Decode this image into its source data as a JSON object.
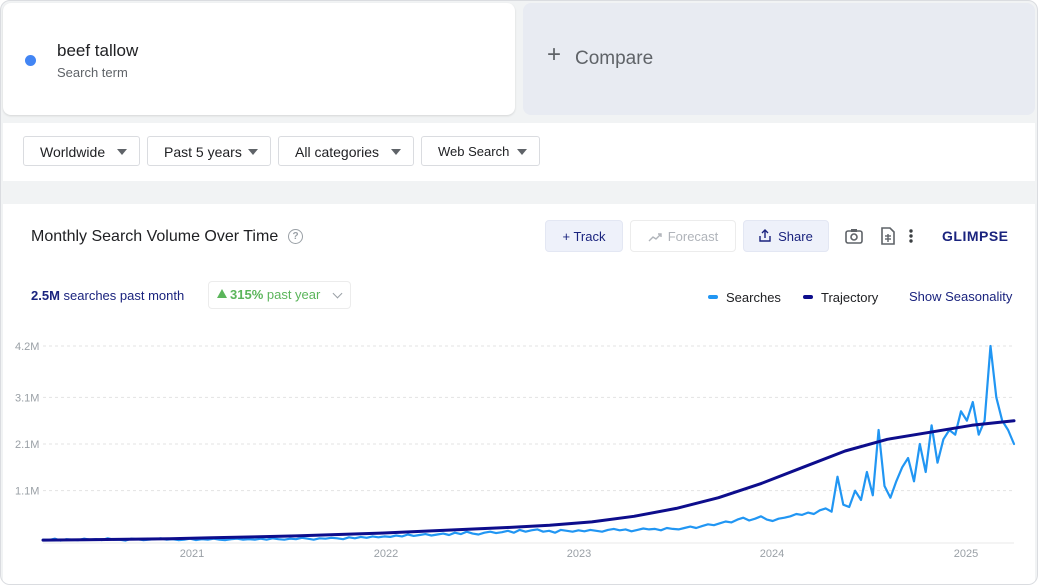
{
  "search_term": {
    "name": "beef tallow",
    "subtitle": "Search term"
  },
  "compare": {
    "label": "Compare"
  },
  "filters": {
    "region": "Worldwide",
    "time": "Past 5 years",
    "category": "All categories",
    "source": "Web Search"
  },
  "panel": {
    "title": "Monthly Search Volume Over Time",
    "track_label": "+ Track",
    "forecast_label": "Forecast",
    "share_label": "Share",
    "logo": "GLIMPSE",
    "searches_value": "2.5M",
    "searches_suffix": "searches past month",
    "growth_value": "315%",
    "growth_suffix": "past year",
    "legend_searches": "Searches",
    "legend_trajectory": "Trajectory",
    "show_seasonality": "Show Seasonality"
  },
  "colors": {
    "searches": "#2196f3",
    "trajectory": "#0d0d8c",
    "growth": "#5bb55b",
    "accent": "#1a237e"
  },
  "chart_data": {
    "type": "line",
    "yticks": [
      "4.2M",
      "3.1M",
      "2.1M",
      "1.1M"
    ],
    "ytick_values": [
      4.2,
      3.1,
      2.1,
      1.1
    ],
    "xticks": [
      "2021",
      "2022",
      "2023",
      "2024",
      "2025"
    ],
    "ylim": [
      0,
      4.2
    ],
    "y_unit": "M",
    "series": [
      {
        "name": "Searches",
        "values": [
          0.05,
          0.04,
          0.07,
          0.03,
          0.06,
          0.05,
          0.04,
          0.07,
          0.05,
          0.06,
          0.04,
          0.08,
          0.05,
          0.05,
          0.03,
          0.07,
          0.06,
          0.04,
          0.05,
          0.06,
          0.08,
          0.05,
          0.06,
          0.04,
          0.05,
          0.07,
          0.04,
          0.06,
          0.05,
          0.07,
          0.05,
          0.04,
          0.06,
          0.07,
          0.05,
          0.06,
          0.05,
          0.07,
          0.05,
          0.08,
          0.06,
          0.05,
          0.07,
          0.06,
          0.09,
          0.07,
          0.05,
          0.08,
          0.07,
          0.09,
          0.08,
          0.06,
          0.1,
          0.08,
          0.11,
          0.09,
          0.12,
          0.1,
          0.12,
          0.11,
          0.14,
          0.12,
          0.16,
          0.13,
          0.15,
          0.17,
          0.14,
          0.16,
          0.18,
          0.15,
          0.2,
          0.17,
          0.22,
          0.18,
          0.16,
          0.2,
          0.22,
          0.19,
          0.21,
          0.24,
          0.2,
          0.26,
          0.22,
          0.25,
          0.27,
          0.22,
          0.24,
          0.2,
          0.26,
          0.24,
          0.22,
          0.25,
          0.23,
          0.26,
          0.24,
          0.22,
          0.26,
          0.28,
          0.25,
          0.27,
          0.23,
          0.26,
          0.29,
          0.27,
          0.28,
          0.25,
          0.3,
          0.28,
          0.27,
          0.3,
          0.33,
          0.3,
          0.34,
          0.38,
          0.36,
          0.4,
          0.44,
          0.42,
          0.48,
          0.52,
          0.46,
          0.5,
          0.55,
          0.48,
          0.45,
          0.5,
          0.52,
          0.55,
          0.6,
          0.58,
          0.63,
          0.6,
          0.68,
          0.72,
          0.65,
          1.4,
          0.8,
          0.75,
          1.1,
          0.9,
          1.5,
          1.0,
          2.4,
          1.2,
          0.95,
          1.3,
          1.6,
          1.8,
          1.3,
          2.1,
          1.5,
          2.5,
          1.7,
          2.2,
          2.4,
          2.3,
          2.8,
          2.6,
          3.0,
          2.3,
          2.6,
          4.2,
          3.1,
          2.6,
          2.4,
          2.1
        ]
      },
      {
        "name": "Trajectory",
        "values": [
          0.04,
          0.05,
          0.06,
          0.07,
          0.09,
          0.11,
          0.13,
          0.16,
          0.19,
          0.23,
          0.27,
          0.31,
          0.36,
          0.43,
          0.55,
          0.72,
          0.95,
          1.25,
          1.6,
          1.95,
          2.2,
          2.35,
          2.5,
          2.6
        ]
      }
    ]
  }
}
